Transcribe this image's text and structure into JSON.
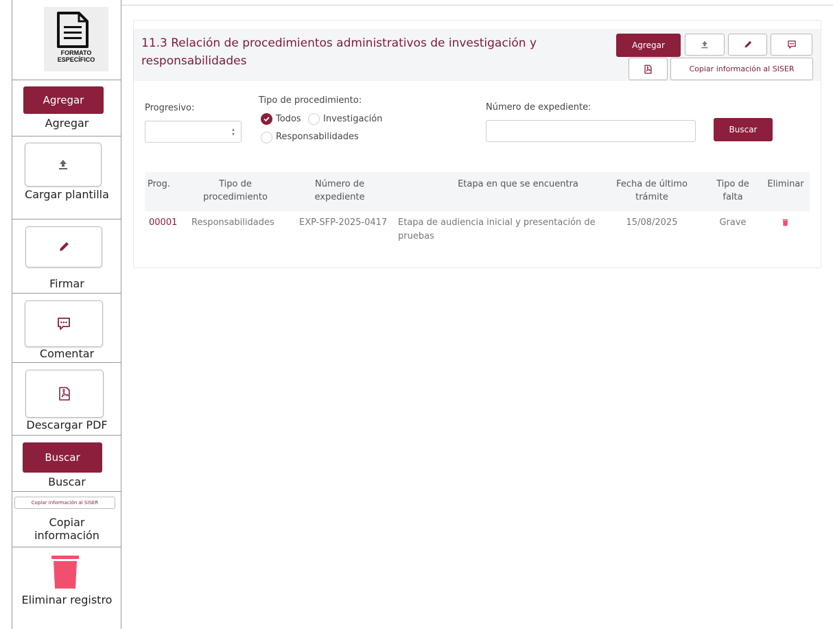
{
  "legend": {
    "format_logo_text": "FORMATO ESPECÍFICO",
    "items": [
      {
        "button_text": "Agregar",
        "label": "Agregar"
      },
      {
        "icon": "upload-icon",
        "label": "Cargar plantilla"
      },
      {
        "icon": "pen-icon",
        "label": "Firmar"
      },
      {
        "icon": "comment-icon",
        "label": "Comentar"
      },
      {
        "icon": "pdf-icon",
        "label": "Descargar PDF"
      },
      {
        "button_text": "Buscar",
        "label": "Buscar"
      },
      {
        "button_text": "Copiar información al SISER",
        "label": "Copiar información"
      },
      {
        "icon": "trash-icon",
        "label": "Eliminar registro"
      }
    ]
  },
  "panel": {
    "title": "11.3 Relación de procedimientos administrativos de investigación y responsabilidades",
    "toolbar": {
      "agregar": "Agregar",
      "copiar_siser": "Copiar información al SISER",
      "icons": [
        "upload-icon",
        "pen-icon",
        "comment-icon",
        "pdf-icon"
      ]
    },
    "filters": {
      "progresivo_label": "Progresivo:",
      "progresivo_value": "",
      "tipo_label": "Tipo de procedimiento:",
      "options": [
        {
          "label": "Todos",
          "checked": true
        },
        {
          "label": "Investigación",
          "checked": false
        },
        {
          "label": "Responsabilidades",
          "checked": false
        }
      ],
      "expediente_label": "Número de expediente:",
      "expediente_value": "",
      "buscar": "Buscar"
    },
    "table": {
      "headers": [
        "Prog.",
        "Tipo de procedimiento",
        "Número de expediente",
        "Etapa en que se encuentra",
        "Fecha de último trámite",
        "Tipo de falta",
        "Eliminar"
      ],
      "rows": [
        {
          "prog": "00001",
          "tipo": "Responsabilidades",
          "expediente": "EXP-SFP-2025-0417",
          "etapa": "Etapa de audiencia inicial y presentación de pruebas",
          "fecha": "15/08/2025",
          "falta": "Grave"
        }
      ]
    }
  },
  "colors": {
    "primary": "#8b1f3c",
    "title": "#7a1d39",
    "trash": "#f0506e"
  }
}
